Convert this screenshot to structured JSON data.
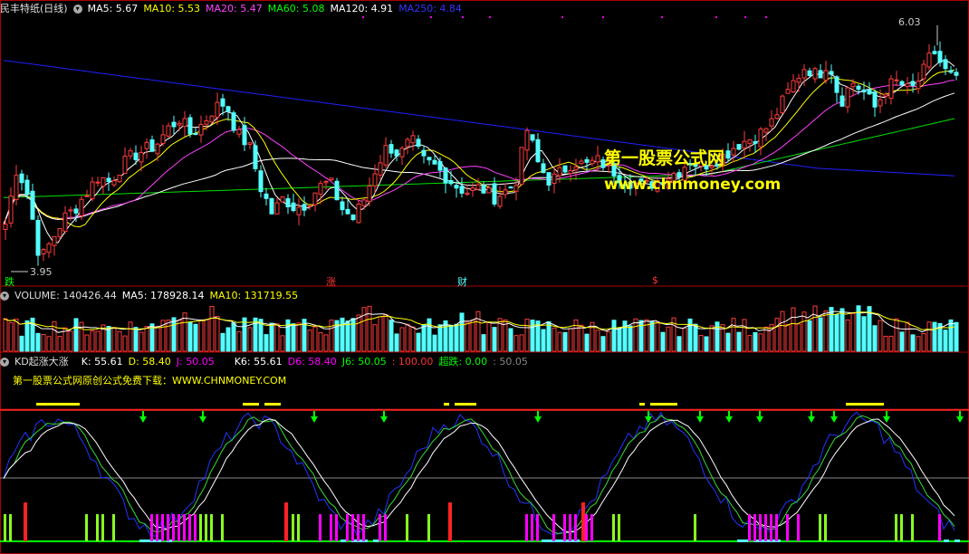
{
  "colors": {
    "up": "#ff3c3c",
    "down": "#54ffff",
    "ma5": "#ffffff",
    "ma10": "#ffff00",
    "ma20": "#ff40ff",
    "ma60": "#00e000",
    "ma120": "#ffffff",
    "ma250": "#2020ff",
    "kd_k": "#ffffff",
    "kd_d": "#ffff00",
    "kd_j": "#ff00ff",
    "k6": "#ffffff",
    "d6": "#ff00ff",
    "j6": "#00ff00",
    "watermark": "#ffff00"
  },
  "main_header": {
    "title": "民丰特纸(日线)",
    "ma5": "MA5: 5.67",
    "ma10": "MA10: 5.53",
    "ma20": "MA20: 5.47",
    "ma60": "MA60: 5.08",
    "ma120": "MA120: 4.91",
    "ma250": "MA250: 4.84"
  },
  "volume_header": {
    "title": "VOLUME: 140426.44",
    "ma5": "MA5: 178928.14",
    "ma10": "MA10: 131719.55"
  },
  "kd_header": {
    "title": "KD起涨大涨",
    "k": "K: 55.61",
    "d": "D: 58.40",
    "j": "J: 50.05",
    "k6": "K6: 55.61",
    "d6": "D6: 58.40",
    "j6": "J6: 50.05",
    "v100": ": 100.00",
    "chaodie": "超跌: 0.00",
    "v50": ": 50.05"
  },
  "watermark": {
    "line1": "第一股票公式网",
    "line2": "www.chnmoney.com",
    "promo": "第一股票公式网原创公式免费下载：WWW.CHNMONEY.COM"
  },
  "annotations": {
    "high": "6.03",
    "low": "3.95",
    "mark_die": "跌",
    "mark_zhang": "涨",
    "mark_cai": "财",
    "mark_s": "$"
  },
  "chart_data": [
    {
      "type": "candlestick",
      "title": "民丰特纸(日线)",
      "ylim": [
        3.9,
        6.3
      ],
      "high_label": 6.03,
      "low_label": 3.95,
      "series_ma": [
        "MA5",
        "MA10",
        "MA20",
        "MA60",
        "MA120",
        "MA250"
      ],
      "close_path": [
        4.35,
        4.9,
        4.6,
        4.0,
        4.2,
        4.4,
        4.5,
        4.65,
        4.8,
        4.75,
        4.9,
        5.0,
        5.05,
        5.1,
        5.25,
        5.35,
        5.2,
        5.3,
        5.45,
        5.5,
        5.2,
        5.1,
        4.7,
        4.45,
        4.6,
        4.5,
        4.55,
        4.7,
        4.75,
        4.5,
        4.4,
        4.6,
        4.9,
        5.1,
        5.0,
        5.15,
        4.95,
        4.9,
        4.8,
        4.7,
        4.65,
        4.7,
        4.6,
        4.65,
        4.75,
        5.25,
        4.9,
        4.75,
        4.85,
        4.95,
        4.9,
        4.95,
        4.9,
        4.8,
        4.75,
        4.7,
        4.75,
        4.8,
        4.85,
        4.95,
        4.9,
        4.95,
        5.0,
        5.1,
        5.15,
        5.2,
        5.3,
        5.5,
        5.7,
        5.85,
        5.75,
        5.9,
        5.5,
        5.7,
        5.6,
        5.45,
        5.65,
        5.7,
        5.6,
        5.75,
        6.0,
        5.8,
        5.7
      ]
    },
    {
      "type": "bar",
      "title": "VOLUME",
      "values": [
        140426.44
      ],
      "ma5": 178928.14,
      "ma10": 131719.55
    },
    {
      "type": "line",
      "title": "KD起涨大涨",
      "ylim": [
        0,
        100
      ],
      "k": 55.61,
      "d": 58.4,
      "j": 50.05,
      "k6": 55.61,
      "d6": 58.4,
      "j6": 50.05
    }
  ]
}
